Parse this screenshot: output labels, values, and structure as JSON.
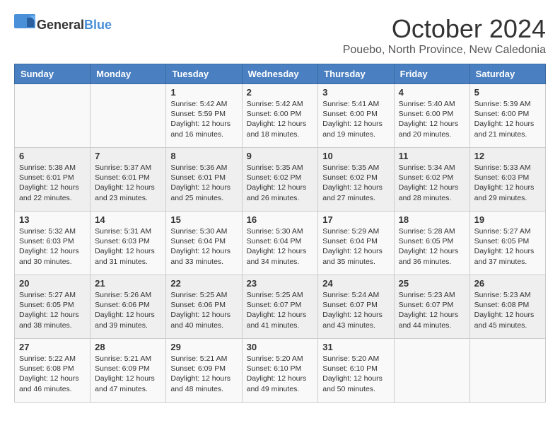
{
  "logo": {
    "general": "General",
    "blue": "Blue"
  },
  "title": "October 2024",
  "location": "Pouebo, North Province, New Caledonia",
  "days_of_week": [
    "Sunday",
    "Monday",
    "Tuesday",
    "Wednesday",
    "Thursday",
    "Friday",
    "Saturday"
  ],
  "weeks": [
    [
      {
        "day": null,
        "info": null
      },
      {
        "day": null,
        "info": null
      },
      {
        "day": "1",
        "info": "Sunrise: 5:42 AM\nSunset: 5:59 PM\nDaylight: 12 hours and 16 minutes."
      },
      {
        "day": "2",
        "info": "Sunrise: 5:42 AM\nSunset: 6:00 PM\nDaylight: 12 hours and 18 minutes."
      },
      {
        "day": "3",
        "info": "Sunrise: 5:41 AM\nSunset: 6:00 PM\nDaylight: 12 hours and 19 minutes."
      },
      {
        "day": "4",
        "info": "Sunrise: 5:40 AM\nSunset: 6:00 PM\nDaylight: 12 hours and 20 minutes."
      },
      {
        "day": "5",
        "info": "Sunrise: 5:39 AM\nSunset: 6:00 PM\nDaylight: 12 hours and 21 minutes."
      }
    ],
    [
      {
        "day": "6",
        "info": "Sunrise: 5:38 AM\nSunset: 6:01 PM\nDaylight: 12 hours and 22 minutes."
      },
      {
        "day": "7",
        "info": "Sunrise: 5:37 AM\nSunset: 6:01 PM\nDaylight: 12 hours and 23 minutes."
      },
      {
        "day": "8",
        "info": "Sunrise: 5:36 AM\nSunset: 6:01 PM\nDaylight: 12 hours and 25 minutes."
      },
      {
        "day": "9",
        "info": "Sunrise: 5:35 AM\nSunset: 6:02 PM\nDaylight: 12 hours and 26 minutes."
      },
      {
        "day": "10",
        "info": "Sunrise: 5:35 AM\nSunset: 6:02 PM\nDaylight: 12 hours and 27 minutes."
      },
      {
        "day": "11",
        "info": "Sunrise: 5:34 AM\nSunset: 6:02 PM\nDaylight: 12 hours and 28 minutes."
      },
      {
        "day": "12",
        "info": "Sunrise: 5:33 AM\nSunset: 6:03 PM\nDaylight: 12 hours and 29 minutes."
      }
    ],
    [
      {
        "day": "13",
        "info": "Sunrise: 5:32 AM\nSunset: 6:03 PM\nDaylight: 12 hours and 30 minutes."
      },
      {
        "day": "14",
        "info": "Sunrise: 5:31 AM\nSunset: 6:03 PM\nDaylight: 12 hours and 31 minutes."
      },
      {
        "day": "15",
        "info": "Sunrise: 5:30 AM\nSunset: 6:04 PM\nDaylight: 12 hours and 33 minutes."
      },
      {
        "day": "16",
        "info": "Sunrise: 5:30 AM\nSunset: 6:04 PM\nDaylight: 12 hours and 34 minutes."
      },
      {
        "day": "17",
        "info": "Sunrise: 5:29 AM\nSunset: 6:04 PM\nDaylight: 12 hours and 35 minutes."
      },
      {
        "day": "18",
        "info": "Sunrise: 5:28 AM\nSunset: 6:05 PM\nDaylight: 12 hours and 36 minutes."
      },
      {
        "day": "19",
        "info": "Sunrise: 5:27 AM\nSunset: 6:05 PM\nDaylight: 12 hours and 37 minutes."
      }
    ],
    [
      {
        "day": "20",
        "info": "Sunrise: 5:27 AM\nSunset: 6:05 PM\nDaylight: 12 hours and 38 minutes."
      },
      {
        "day": "21",
        "info": "Sunrise: 5:26 AM\nSunset: 6:06 PM\nDaylight: 12 hours and 39 minutes."
      },
      {
        "day": "22",
        "info": "Sunrise: 5:25 AM\nSunset: 6:06 PM\nDaylight: 12 hours and 40 minutes."
      },
      {
        "day": "23",
        "info": "Sunrise: 5:25 AM\nSunset: 6:07 PM\nDaylight: 12 hours and 41 minutes."
      },
      {
        "day": "24",
        "info": "Sunrise: 5:24 AM\nSunset: 6:07 PM\nDaylight: 12 hours and 43 minutes."
      },
      {
        "day": "25",
        "info": "Sunrise: 5:23 AM\nSunset: 6:07 PM\nDaylight: 12 hours and 44 minutes."
      },
      {
        "day": "26",
        "info": "Sunrise: 5:23 AM\nSunset: 6:08 PM\nDaylight: 12 hours and 45 minutes."
      }
    ],
    [
      {
        "day": "27",
        "info": "Sunrise: 5:22 AM\nSunset: 6:08 PM\nDaylight: 12 hours and 46 minutes."
      },
      {
        "day": "28",
        "info": "Sunrise: 5:21 AM\nSunset: 6:09 PM\nDaylight: 12 hours and 47 minutes."
      },
      {
        "day": "29",
        "info": "Sunrise: 5:21 AM\nSunset: 6:09 PM\nDaylight: 12 hours and 48 minutes."
      },
      {
        "day": "30",
        "info": "Sunrise: 5:20 AM\nSunset: 6:10 PM\nDaylight: 12 hours and 49 minutes."
      },
      {
        "day": "31",
        "info": "Sunrise: 5:20 AM\nSunset: 6:10 PM\nDaylight: 12 hours and 50 minutes."
      },
      {
        "day": null,
        "info": null
      },
      {
        "day": null,
        "info": null
      }
    ]
  ]
}
